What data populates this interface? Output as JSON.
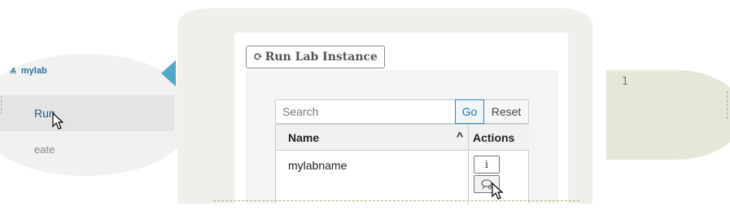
{
  "sidebar": {
    "section_title": "mylab",
    "section_icon": "flask-icon",
    "items": [
      {
        "label": "Run",
        "active": true
      },
      {
        "label": "Create",
        "visible_text": "eate",
        "active": false
      }
    ]
  },
  "panel": {
    "title_icon": "refresh-icon",
    "title": "Run Lab Instance",
    "search": {
      "placeholder": "Search",
      "value": ""
    },
    "go_label": "Go",
    "reset_label": "Reset",
    "table": {
      "columns": [
        "Name",
        "Actions"
      ],
      "sort_icon": "chevron-up-icon",
      "rows": [
        {
          "name": "mylabname",
          "actions": [
            {
              "icon": "info-icon",
              "label": "i"
            },
            {
              "icon": "run-icon"
            }
          ]
        }
      ]
    }
  },
  "editor": {
    "line_numbers": [
      "1"
    ]
  },
  "colors": {
    "accent": "#2a85c8",
    "sidebar_link": "#265a88",
    "sidebar_tip": "#4fa8c7",
    "editor_gutter": "#e5e8d9"
  }
}
